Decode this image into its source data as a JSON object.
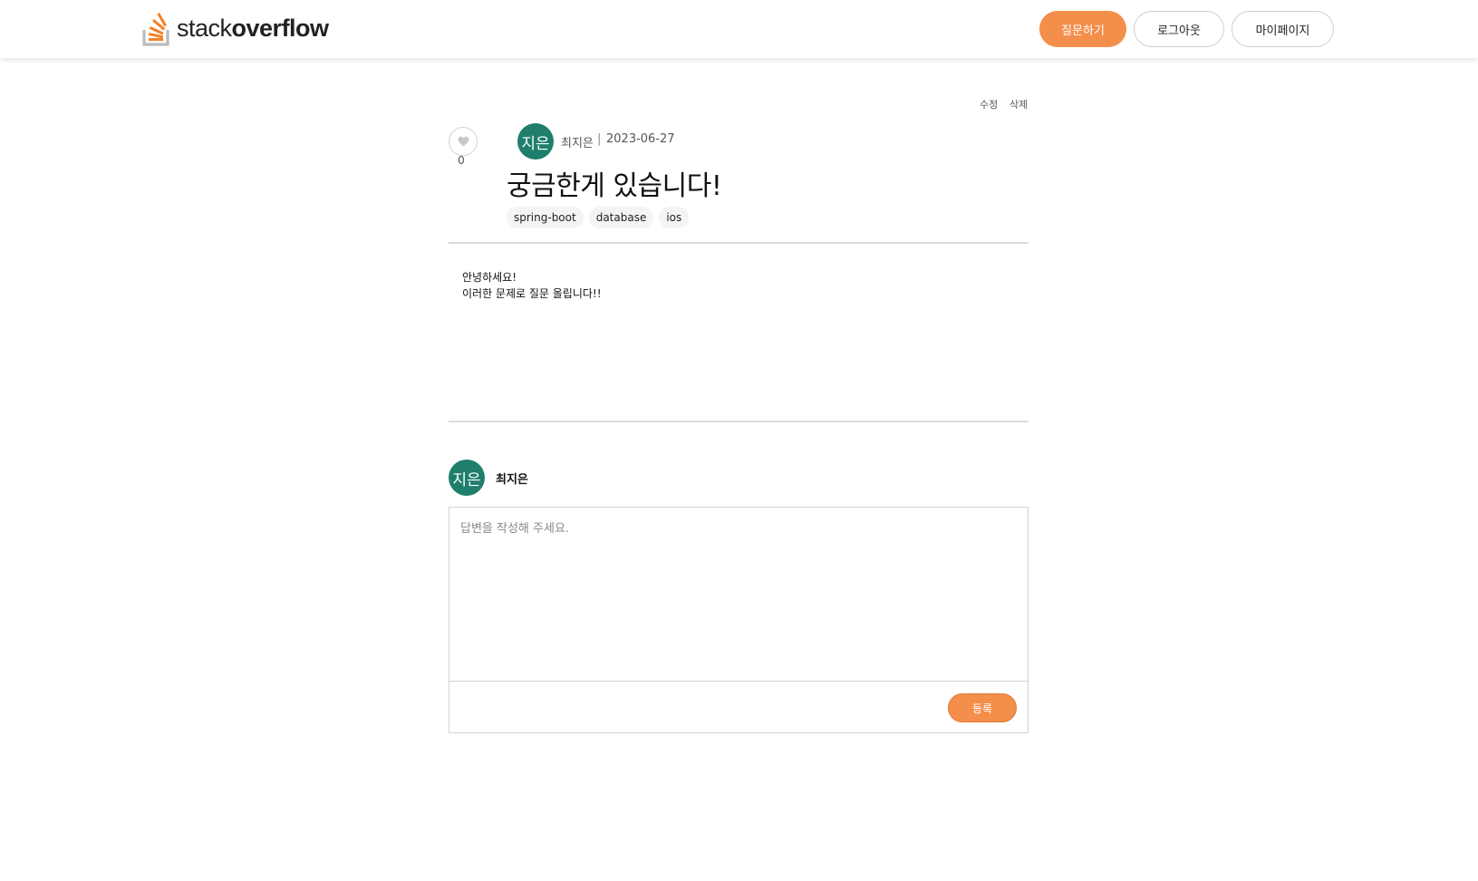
{
  "header": {
    "logo_light": "stack",
    "logo_bold": "overflow",
    "ask_label": "질문하기",
    "logout_label": "로그아웃",
    "mypage_label": "마이페이지"
  },
  "post": {
    "edit_label": "수정",
    "delete_label": "삭제",
    "like_count": "0",
    "avatar_text": "지은",
    "author": "최지은",
    "separator": "|",
    "date": "2023-06-27",
    "title": "궁금한게 있습니다!",
    "tags": [
      "spring-boot",
      "database",
      "ios"
    ],
    "body_lines": [
      "안녕하세요!",
      "이러한 문제로 질문 올립니다!!"
    ]
  },
  "answer": {
    "avatar_text": "지은",
    "author": "최지은",
    "placeholder": "답변을 작성해 주세요.",
    "submit_label": "등록"
  },
  "colors": {
    "accent": "#f48e4b",
    "avatar": "#1f7e6c"
  },
  "icons": {
    "logo": "stackoverflow-logo-icon",
    "like": "heart-icon"
  }
}
